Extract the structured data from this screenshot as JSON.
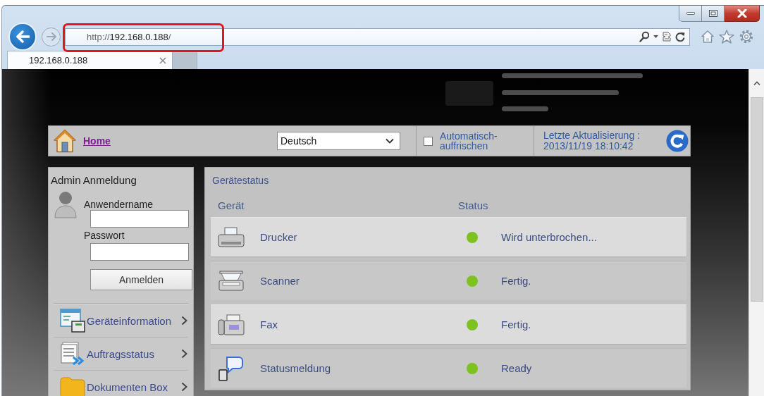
{
  "browser": {
    "address": {
      "url": "http://**192.168.0.188**/",
      "highlighted": true
    },
    "tabs": [
      {
        "title": "192.168.0.188",
        "selected": true
      }
    ]
  },
  "toolbar": {
    "home_link": "Home",
    "language": "Deutsch",
    "auto_refresh": {
      "label": "Automatisch-auffrischen",
      "checked": false
    },
    "last_update": {
      "label": "Letzte Aktualisierung :",
      "value": "2013/11/19 18:10:42"
    }
  },
  "login": {
    "title": "Admin Anmeldung",
    "fields": [
      {
        "label": "Anwendername"
      },
      {
        "label": "Passwort"
      }
    ],
    "button": "Anmelden"
  },
  "menu": [
    {
      "label": "Geräteinformation",
      "kind": "device-info"
    },
    {
      "label": "Auftragsstatus",
      "kind": "jobs"
    },
    {
      "label": "Dokumenten Box",
      "kind": "box"
    }
  ],
  "device_status": {
    "title": "Gerätestatus",
    "columns": [
      "Gerät",
      "Status"
    ],
    "rows": [
      {
        "device": "Drucker",
        "kind": "printer",
        "status": "Wird unterbrochen...",
        "color": "#7dc21e"
      },
      {
        "device": "Scanner",
        "kind": "scanner",
        "status": "Fertig.",
        "color": "#7dc21e"
      },
      {
        "device": "Fax",
        "kind": "fax",
        "status": "Fertig.",
        "color": "#7dc21e"
      },
      {
        "device": "Statusmeldung",
        "kind": "message",
        "status": "Ready",
        "color": "#7dc21e"
      }
    ]
  }
}
